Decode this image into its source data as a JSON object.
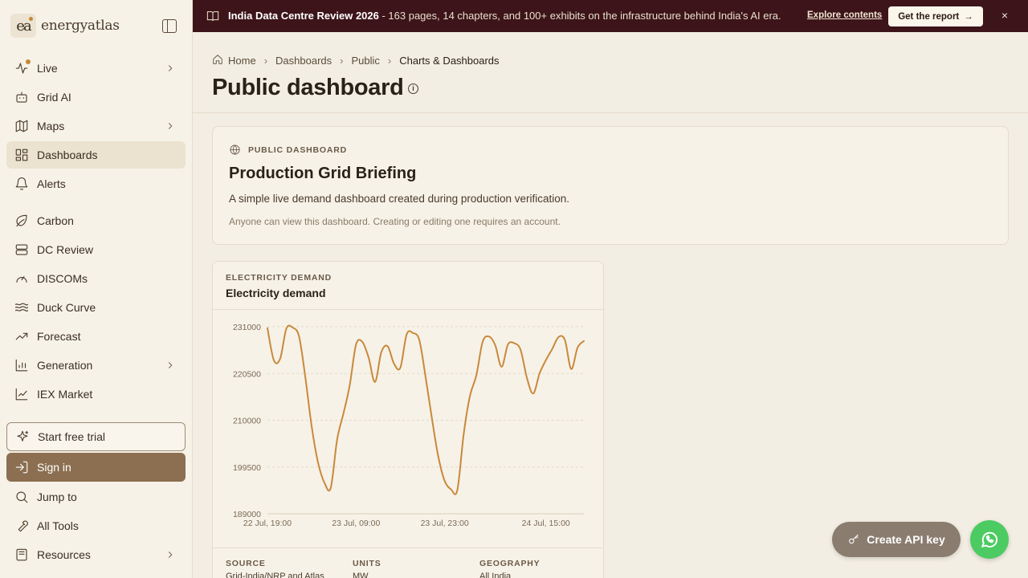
{
  "app": {
    "logo_mark": "ea",
    "logo_text": "energyatlas"
  },
  "sidebar": {
    "items": [
      {
        "label": "Live",
        "icon": "pulse-icon",
        "chevron": true
      },
      {
        "label": "Grid AI",
        "icon": "bot-icon",
        "chevron": false
      },
      {
        "label": "Maps",
        "icon": "map-icon",
        "chevron": true
      },
      {
        "label": "Dashboards",
        "icon": "dashboard-icon",
        "chevron": false,
        "active": true
      },
      {
        "label": "Alerts",
        "icon": "bell-icon",
        "chevron": false
      },
      {
        "label": "Carbon",
        "icon": "leaf-icon",
        "chevron": false
      },
      {
        "label": "DC Review",
        "icon": "server-icon",
        "chevron": false
      },
      {
        "label": "DISCOMs",
        "icon": "gauge-icon",
        "chevron": false
      },
      {
        "label": "Duck Curve",
        "icon": "waves-icon",
        "chevron": false
      },
      {
        "label": "Forecast",
        "icon": "trend-up-icon",
        "chevron": false
      },
      {
        "label": "Generation",
        "icon": "bar-chart-icon",
        "chevron": true
      },
      {
        "label": "IEX Market",
        "icon": "line-chart-icon",
        "chevron": false
      }
    ],
    "trial_label": "Start free trial",
    "signin_label": "Sign in",
    "bottom_items": [
      {
        "label": "Jump to",
        "icon": "search-icon",
        "chevron": false
      },
      {
        "label": "All Tools",
        "icon": "wrench-icon",
        "chevron": false
      },
      {
        "label": "Resources",
        "icon": "book-icon",
        "chevron": true
      }
    ]
  },
  "banner": {
    "title": "India Data Centre Review 2026",
    "text": " - 163 pages, 14 chapters, and 100+ exhibits on the infrastructure behind India's AI era.",
    "link": "Explore contents",
    "cta": "Get the report",
    "close": "×"
  },
  "breadcrumb": {
    "home": "Home",
    "items": [
      "Dashboards",
      "Public"
    ],
    "current": "Charts & Dashboards"
  },
  "page": {
    "title": "Public dashboard",
    "info": "i"
  },
  "info_card": {
    "eyebrow": "PUBLIC DASHBOARD",
    "title": "Production Grid Briefing",
    "description": "A simple live demand dashboard created during production verification.",
    "note": "Anyone can view this dashboard. Creating or editing one requires an account."
  },
  "chart_card": {
    "eyebrow": "ELECTRICITY DEMAND",
    "title": "Electricity demand",
    "meta": [
      {
        "label": "SOURCE",
        "value": "Grid-India/NRP and Atlas"
      },
      {
        "label": "UNITS",
        "value": "MW"
      },
      {
        "label": "GEOGRAPHY",
        "value": "All India"
      }
    ]
  },
  "chart_data": {
    "type": "line",
    "title": "Electricity demand",
    "ylim": [
      189000,
      231000
    ],
    "yticks": [
      "231000",
      "220500",
      "210000",
      "199500",
      "189000"
    ],
    "ytick_values": [
      231000,
      220500,
      210000,
      199500,
      189000
    ],
    "xticks": [
      "22 Jul, 19:00",
      "23 Jul, 09:00",
      "23 Jul, 23:00",
      "24 Jul, 15:00"
    ],
    "xtick_index": [
      0,
      14,
      28,
      44
    ],
    "line_color": "#c8893b",
    "series": [
      {
        "values": [
          230700,
          223500,
          223800,
          230600,
          230800,
          228800,
          219500,
          208500,
          200500,
          196000,
          194800,
          205600,
          211500,
          217800,
          227000,
          227600,
          224000,
          218600,
          225300,
          226600,
          222700,
          221800,
          229300,
          229600,
          228000,
          219600,
          210300,
          201800,
          196400,
          194500,
          194300,
          206800,
          215500,
          220000,
          227600,
          228800,
          226800,
          222000,
          227000,
          227300,
          225800,
          219500,
          216000,
          220500,
          223500,
          226000,
          228700,
          228000,
          221500,
          226300,
          227800
        ]
      }
    ]
  },
  "floating": {
    "api_label": "Create API key"
  },
  "colors": {
    "accent": "#8b6f50",
    "banner": "#3c1419",
    "line": "#c8893b",
    "whatsapp": "#4ccb62"
  }
}
